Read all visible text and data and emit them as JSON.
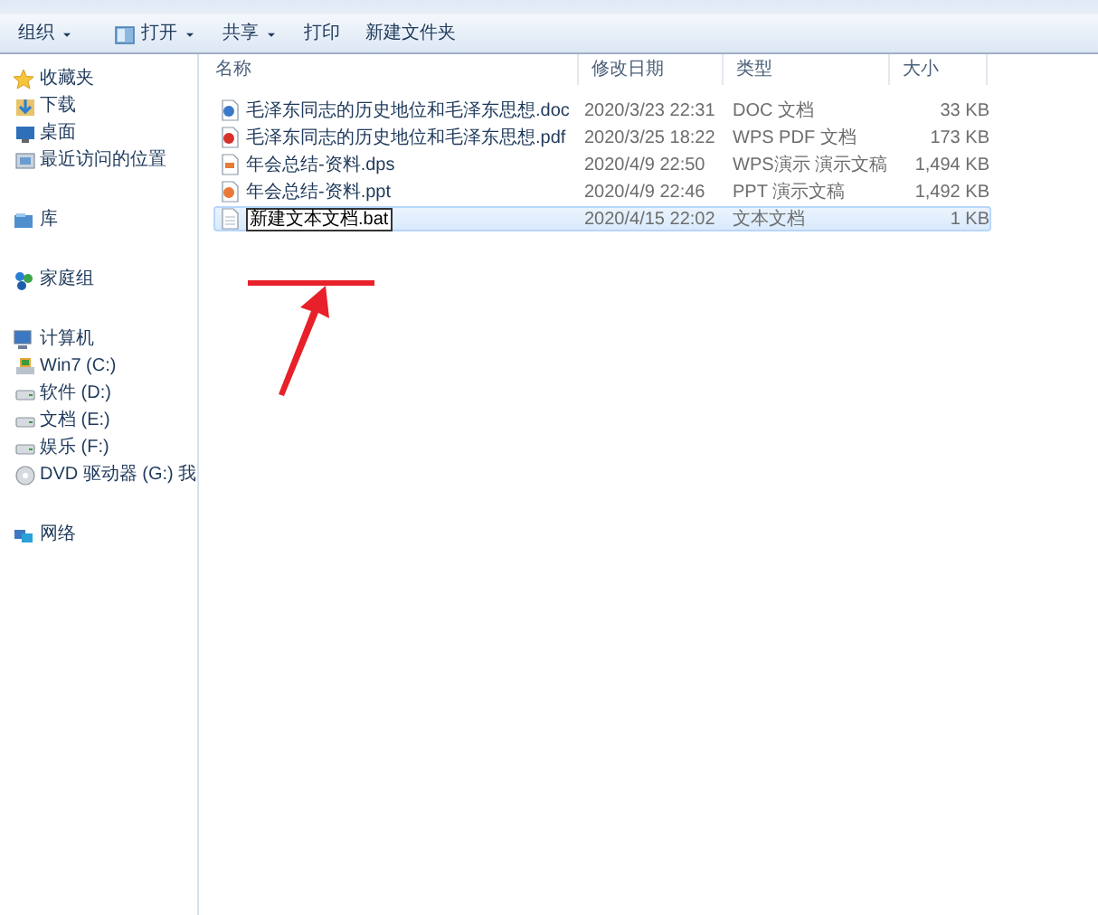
{
  "toolbar": [
    {
      "label": "组织",
      "dropdown": true,
      "kind": "plain"
    },
    {
      "label": "打开",
      "dropdown": true,
      "kind": "open"
    },
    {
      "label": "共享",
      "dropdown": true,
      "kind": "plain"
    },
    {
      "label": "打印",
      "dropdown": false,
      "kind": "plain"
    },
    {
      "label": "新建文件夹",
      "dropdown": false,
      "kind": "plain"
    }
  ],
  "sidebar": {
    "groups": [
      {
        "label": "收藏夹",
        "kind": "star",
        "children": [
          {
            "label": "下载",
            "kind": "download"
          },
          {
            "label": "桌面",
            "kind": "desktop"
          },
          {
            "label": "最近访问的位置",
            "kind": "recent"
          }
        ]
      },
      {
        "label": "库",
        "kind": "library"
      },
      {
        "label": "家庭组",
        "kind": "homegroup"
      },
      {
        "label": "计算机",
        "kind": "computer",
        "children": [
          {
            "label": "Win7 (C:)",
            "kind": "system"
          },
          {
            "label": "软件 (D:)",
            "kind": "drive"
          },
          {
            "label": "文档 (E:)",
            "kind": "drive"
          },
          {
            "label": "娱乐 (F:)",
            "kind": "drive"
          },
          {
            "label": "DVD 驱动器 (G:) 我",
            "kind": "dvd"
          }
        ]
      },
      {
        "label": "网络",
        "kind": "network"
      }
    ]
  },
  "table": {
    "columns": [
      "名称",
      "修改日期",
      "类型",
      "大小"
    ],
    "rows": [
      {
        "name": "毛泽东同志的历史地位和毛泽东思想.doc",
        "date": "2020/3/23 22:31",
        "type": "DOC 文档",
        "size": "33 KB",
        "kind": "doc",
        "selected": false,
        "renaming": false
      },
      {
        "name": "毛泽东同志的历史地位和毛泽东思想.pdf",
        "date": "2020/3/25 18:22",
        "type": "WPS PDF 文档",
        "size": "173 KB",
        "kind": "pdf",
        "selected": false,
        "renaming": false
      },
      {
        "name": "年会总结-资料.dps",
        "date": "2020/4/9 22:50",
        "type": "WPS演示 演示文稿",
        "size": "1,494 KB",
        "kind": "dps",
        "selected": false,
        "renaming": false
      },
      {
        "name": "年会总结-资料.ppt",
        "date": "2020/4/9 22:46",
        "type": "PPT 演示文稿",
        "size": "1,492 KB",
        "kind": "ppt",
        "selected": false,
        "renaming": false
      },
      {
        "name": "新建文本文档.bat",
        "date": "2020/4/15 22:02",
        "type": "文本文档",
        "size": "1 KB",
        "kind": "txt",
        "selected": true,
        "renaming": true
      }
    ]
  }
}
